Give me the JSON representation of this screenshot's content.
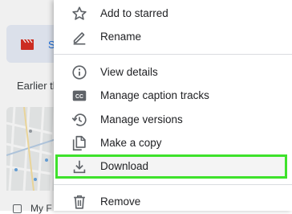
{
  "background": {
    "card_letter": "S",
    "section_label": "Earlier th",
    "bottom_item_label": "My F"
  },
  "menu": {
    "items": [
      {
        "label": "Add to starred",
        "icon": "star-icon"
      },
      {
        "label": "Rename",
        "icon": "pencil-icon"
      },
      {
        "label": "View details",
        "icon": "info-icon"
      },
      {
        "label": "Manage caption tracks",
        "icon": "closed-caption-icon"
      },
      {
        "label": "Manage versions",
        "icon": "history-icon"
      },
      {
        "label": "Make a copy",
        "icon": "copy-icon"
      },
      {
        "label": "Download",
        "icon": "download-icon"
      },
      {
        "label": "Remove",
        "icon": "trash-icon"
      }
    ],
    "highlighted_item": "Download"
  },
  "colors": {
    "highlight_border": "#3ee22b",
    "icon": "#5f6368",
    "text": "#202124",
    "accent": "#1a73e8",
    "clapper": "#d93025"
  }
}
